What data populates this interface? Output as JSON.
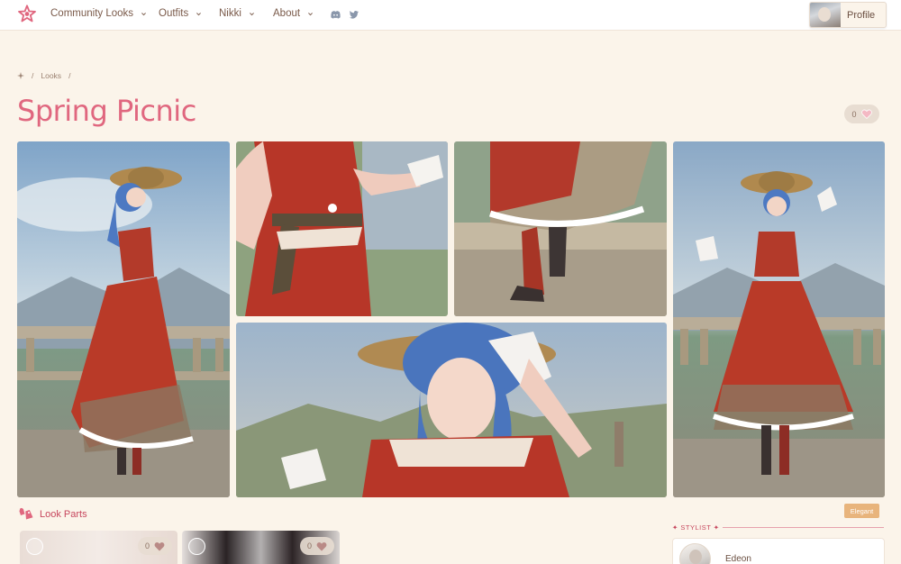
{
  "nav": {
    "logo_icon": "nikki-star-logo",
    "items": [
      {
        "label": "Community Looks",
        "icon": "chevron-down-icon"
      },
      {
        "label": "Outfits",
        "icon": "chevron-down-icon"
      },
      {
        "label": "Nikki",
        "icon": "chevron-down-icon"
      },
      {
        "label": "About",
        "icon": "chevron-down-icon"
      }
    ],
    "social": [
      "discord-icon",
      "twitter-icon"
    ],
    "profile_label": "Profile"
  },
  "breadcrumb": {
    "home_icon": "sparkle-icon",
    "items": [
      "Looks"
    ]
  },
  "page": {
    "title": "Spring Picnic",
    "likes": "0"
  },
  "gallery": {
    "photos": [
      "full-body-side-view",
      "waist-bow-detail",
      "boots-and-skirt-detail",
      "portrait-with-hat",
      "full-body-front-view"
    ]
  },
  "look_parts": {
    "heading": "Look Parts",
    "items": [
      {
        "likes": "0"
      },
      {
        "likes": "0"
      }
    ]
  },
  "tag": "Elegant",
  "stylist": {
    "heading": "✦ STYLIST ✦",
    "name": "Edeon"
  },
  "colors": {
    "background": "#fbf4ea",
    "accent_pink": "#e0677f",
    "tag_orange": "#e8b47c",
    "text_brown": "#7a5a4a"
  }
}
